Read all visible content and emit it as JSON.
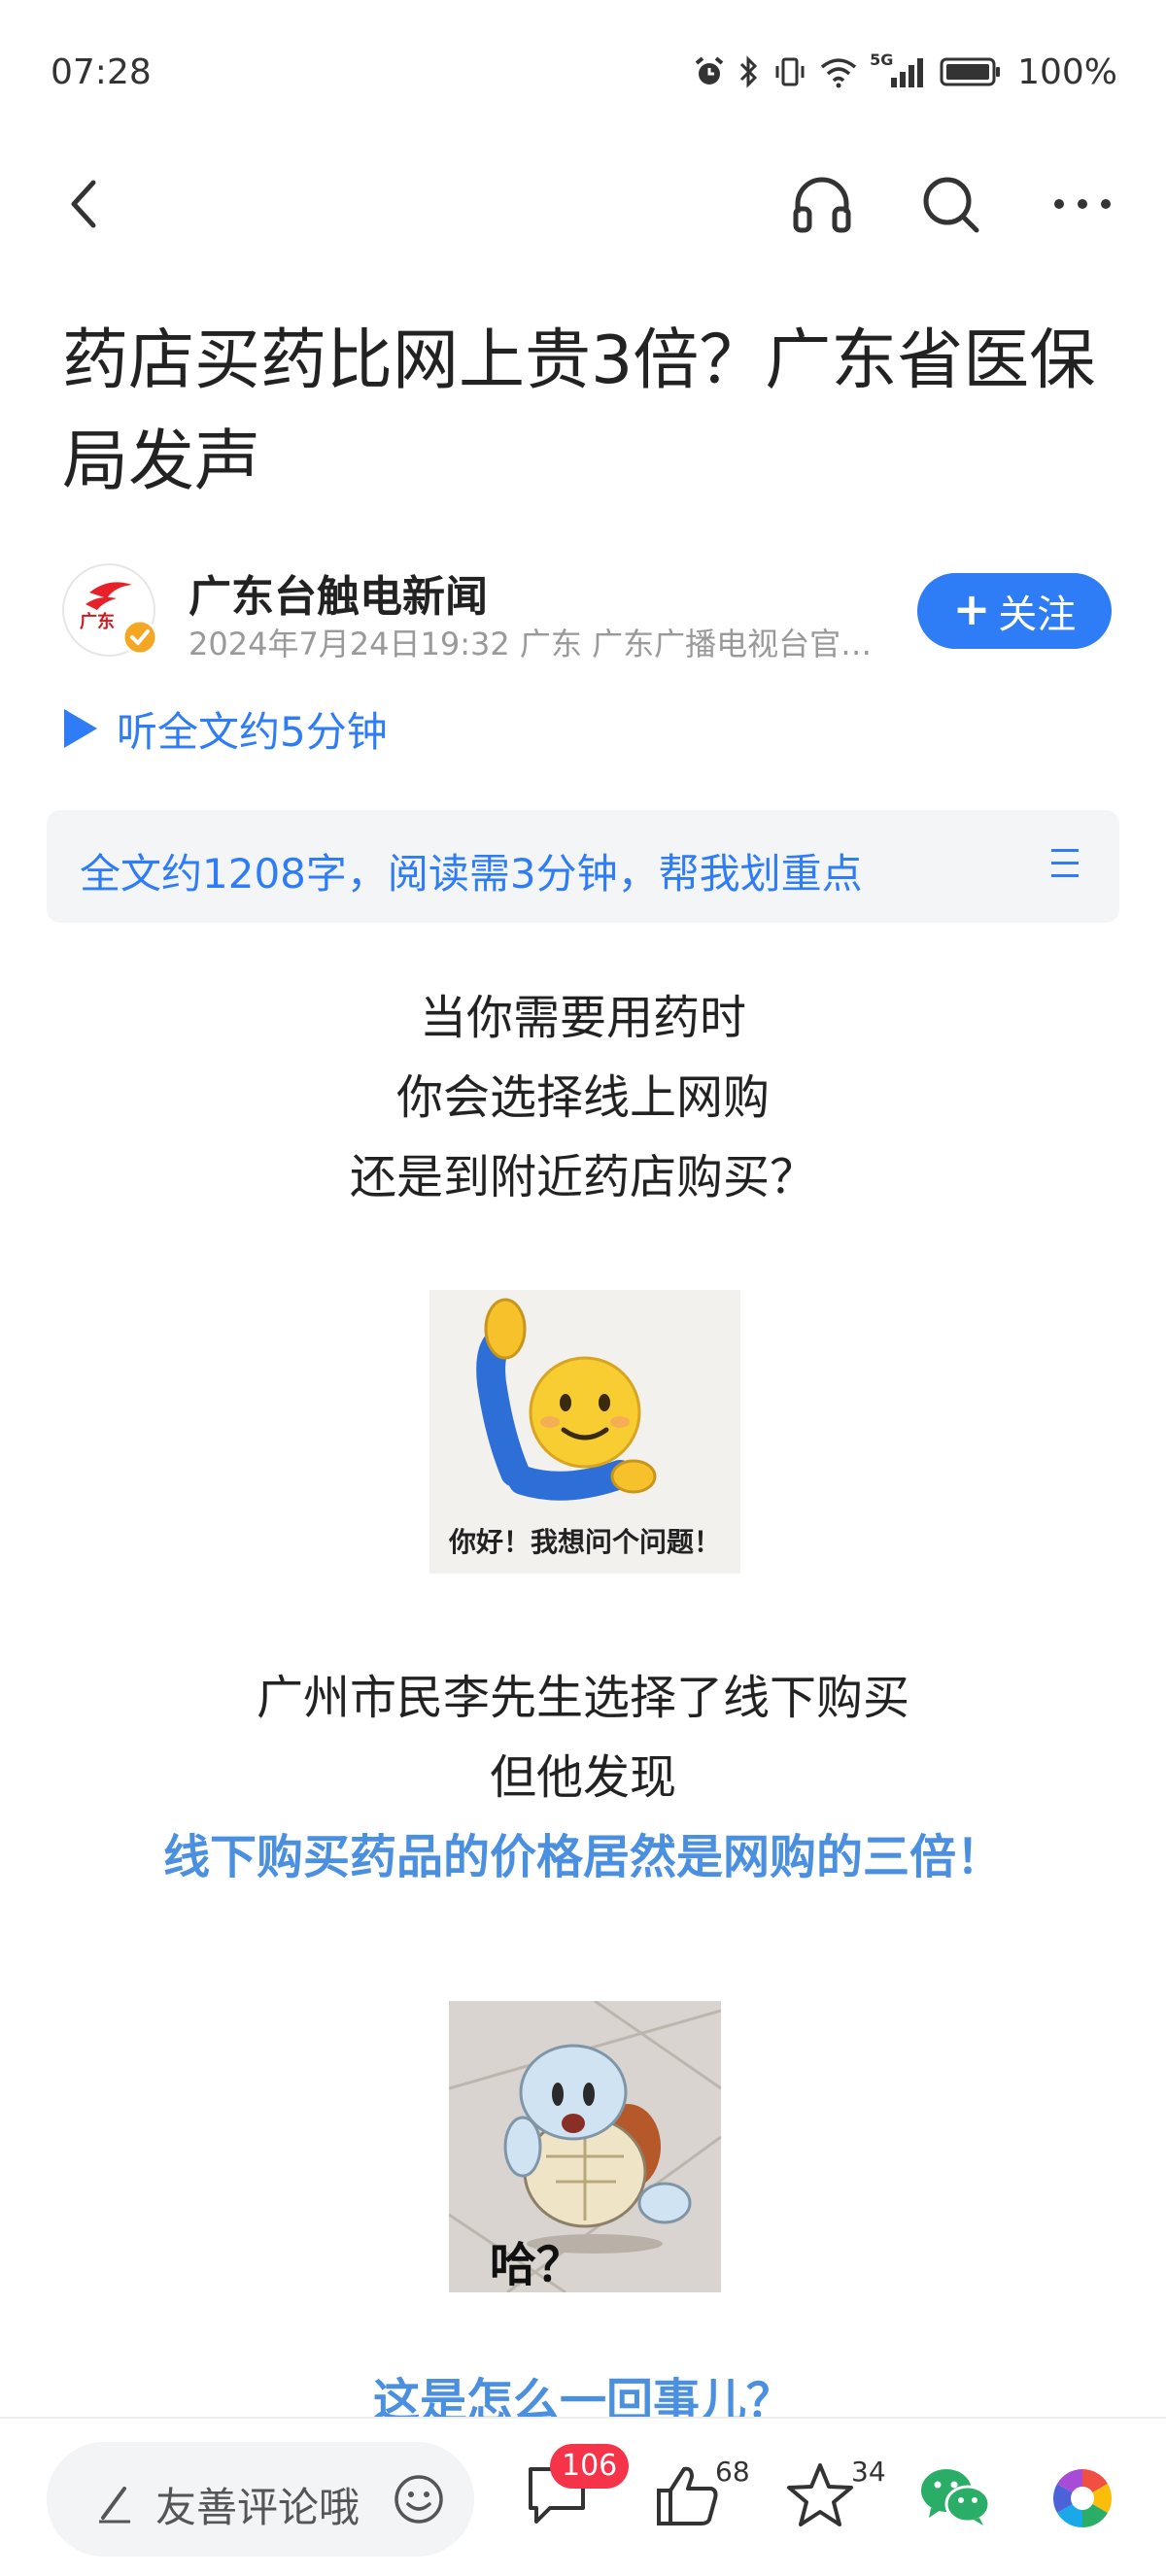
{
  "status": {
    "time": "07:28",
    "network": "5G",
    "battery": "100%"
  },
  "nav": {
    "back": "back",
    "listen": "headphones",
    "search": "search",
    "more": "more"
  },
  "article": {
    "title": "药店买药比网上贵3倍？广东省医保局发声",
    "author": "广东台触电新闻",
    "avatar_text": "广东",
    "meta": "2024年7月24日19:32 广东 广东广播电视台官…",
    "follow": "关注",
    "listen": "听全文约5分钟",
    "summary": "全文约1208字，阅读需3分钟，帮我划重点",
    "para1": [
      "当你需要用药时",
      "你会选择线上网购",
      "还是到附近药店购买？"
    ],
    "emoji_caption": "你好！我想问个问题！",
    "para2": [
      "广州市民李先生选择了线下购买",
      "但他发现"
    ],
    "highlight": "线下购买药品的价格居然是网购的三倍！",
    "squirtle_caption": "哈？",
    "next_heading": "这是怎么一回事儿？"
  },
  "bottom": {
    "comment_placeholder": "友善评论哦",
    "comments": "106",
    "likes": "68",
    "favorites": "34"
  },
  "colors": {
    "accent": "#2e7cf6",
    "highlight": "#4a8fe0",
    "badge": "#f5344a"
  }
}
